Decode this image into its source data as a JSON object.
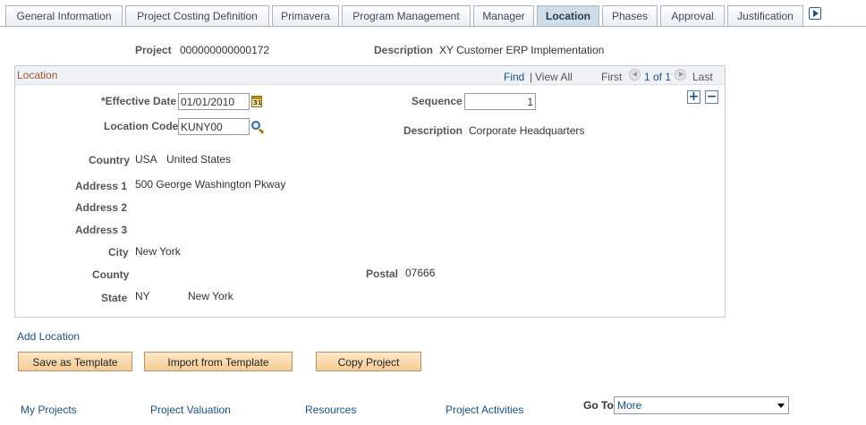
{
  "tabs": [
    {
      "label": "General Information",
      "active": false
    },
    {
      "label": "Project Costing Definition",
      "active": false
    },
    {
      "label": "Primavera",
      "active": false
    },
    {
      "label": "Program Management",
      "active": false
    },
    {
      "label": "Manager",
      "active": false
    },
    {
      "label": "Location",
      "active": true
    },
    {
      "label": "Phases",
      "active": false
    },
    {
      "label": "Approval",
      "active": false
    },
    {
      "label": "Justification",
      "active": false
    }
  ],
  "header": {
    "project_label": "Project",
    "project_value": "000000000000172",
    "description_label": "Description",
    "description_value": "XY Customer ERP Implementation"
  },
  "location": {
    "title": "Location",
    "find": "Find",
    "separator": "|",
    "view_all": "View All",
    "first": "First",
    "page_info": "1 of 1",
    "last": "Last",
    "effective_date_label": "*Effective Date",
    "effective_date_value": "01/01/2010",
    "calendar_glyph": "31",
    "sequence_label": "Sequence",
    "sequence_value": "1",
    "location_code_label": "Location Code",
    "location_code_value": "KUNY00",
    "description_label": "Description",
    "description_value": "Corporate Headquarters",
    "country_label": "Country",
    "country_code": "USA",
    "country_name": "United States",
    "address1_label": "Address 1",
    "address1_value": "500 George Washington Pkway",
    "address2_label": "Address 2",
    "address3_label": "Address 3",
    "city_label": "City",
    "city_value": "New York",
    "county_label": "County",
    "postal_label": "Postal",
    "postal_value": "07666",
    "state_label": "State",
    "state_code": "NY",
    "state_name": "New York",
    "add_row": "+",
    "delete_row": "−"
  },
  "actions": {
    "add_location": "Add Location",
    "save_as_template": "Save as Template",
    "import_from_template": "Import from Template",
    "copy_project": "Copy Project"
  },
  "footer": {
    "links": [
      "My Projects",
      "Project Valuation",
      "Resources",
      "Project Activities"
    ],
    "goto_label": "Go To",
    "goto_value": "More"
  },
  "colors": {
    "active_tab": "#cfdde8",
    "link": "#1b4f87",
    "group_title": "#a0522d",
    "button": "#f6cc95"
  }
}
